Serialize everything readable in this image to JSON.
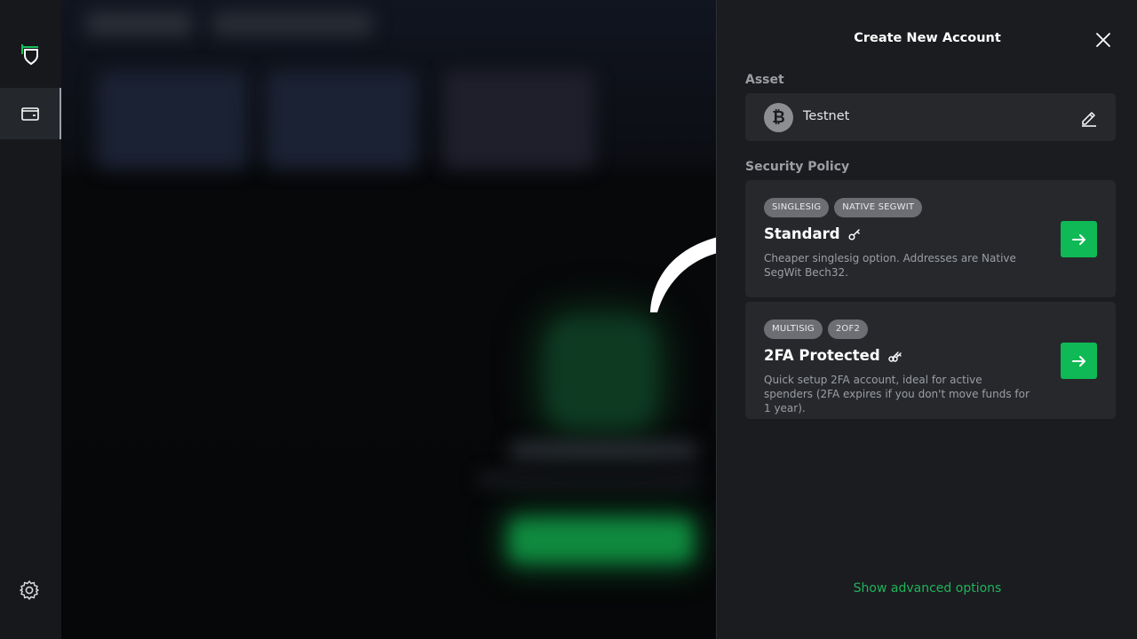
{
  "rail": {
    "items": [
      {
        "icon": "shield-logo-icon",
        "accent": "#16c05c"
      },
      {
        "icon": "wallet-icon",
        "active": true
      },
      {
        "icon": "gear-icon"
      }
    ]
  },
  "panel": {
    "title": "Create New Account",
    "asset_label": "Asset",
    "asset": {
      "name": "Testnet",
      "icon": "bitcoin-icon",
      "coin_symbol": "₿"
    },
    "security_label": "Security Policy",
    "policies": [
      {
        "tags": [
          "SINGLESIG",
          "NATIVE SEGWIT"
        ],
        "title": "Standard",
        "icon": "single-key-icon",
        "description": "Cheaper singlesig option. Addresses are Native SegWit Bech32."
      },
      {
        "tags": [
          "MULTISIG",
          "2OF2"
        ],
        "title": "2FA Protected",
        "icon": "double-key-icon",
        "description": "Quick setup 2FA account, ideal for active spenders (2FA expires if you don't move funds for 1 year)."
      }
    ],
    "advanced_link": "Show advanced options"
  },
  "colors": {
    "accent": "#0fb955",
    "panel_bg": "#1b1c1f",
    "card_bg": "#26282c"
  }
}
